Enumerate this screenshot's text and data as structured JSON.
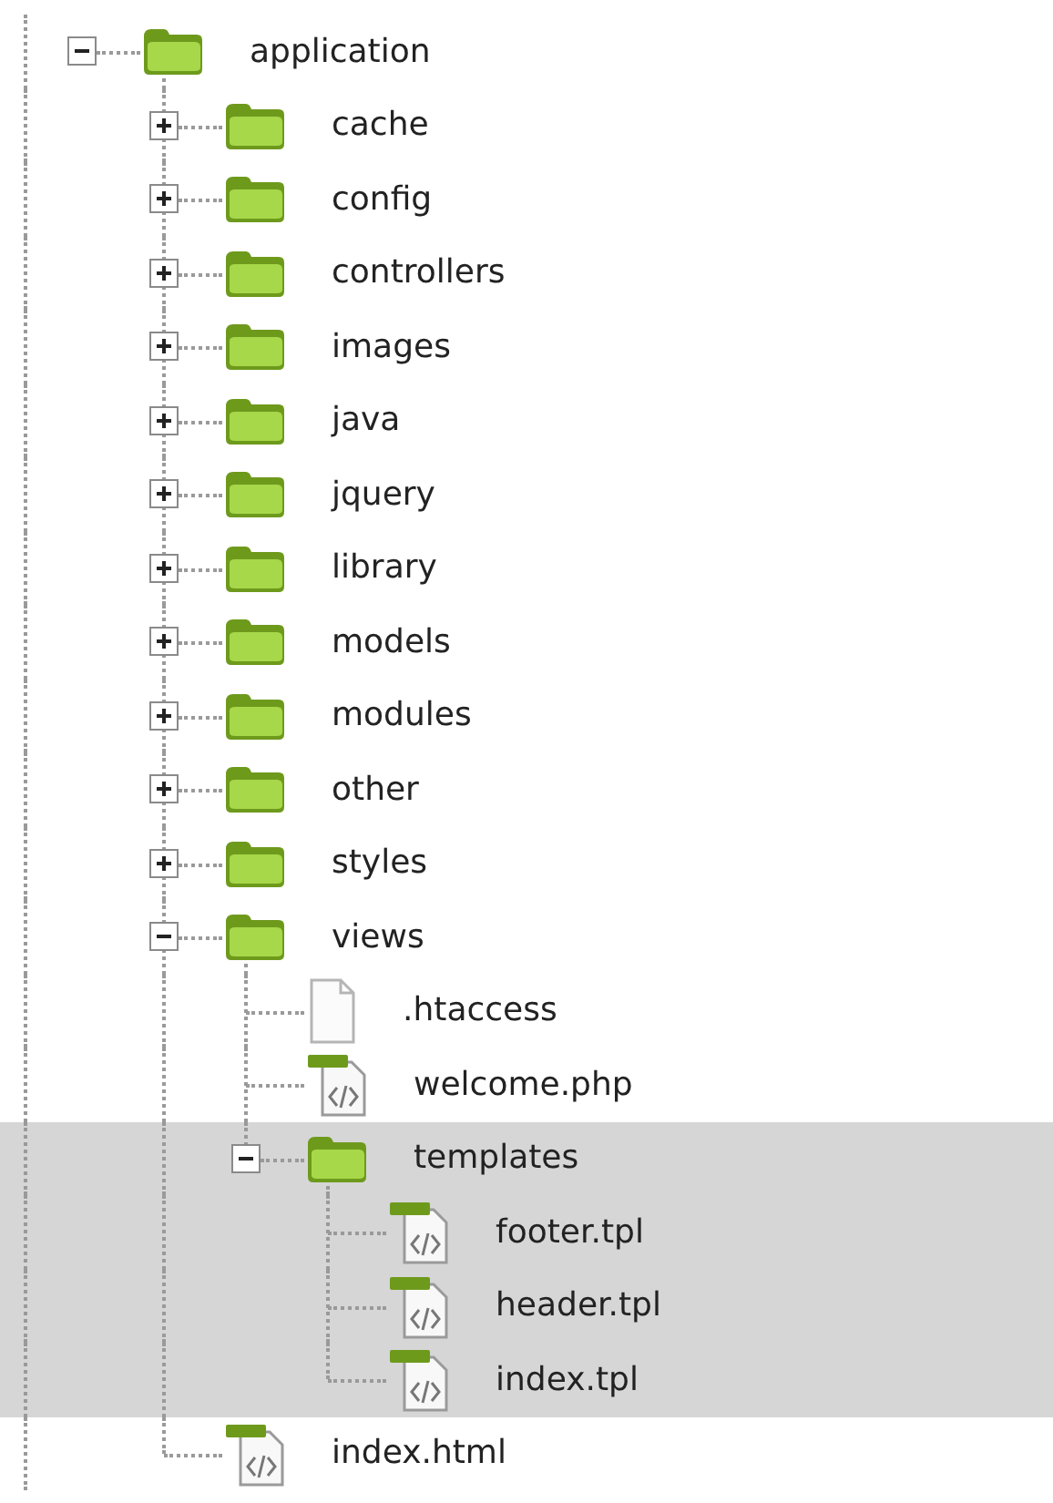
{
  "tree": [
    {
      "label": "application",
      "kind": "folder",
      "expanded": true,
      "selected": false,
      "children": [
        {
          "label": "cache",
          "kind": "folder",
          "expanded": false,
          "selected": false
        },
        {
          "label": "config",
          "kind": "folder",
          "expanded": false,
          "selected": false
        },
        {
          "label": "controllers",
          "kind": "folder",
          "expanded": false,
          "selected": false
        },
        {
          "label": "images",
          "kind": "folder",
          "expanded": false,
          "selected": false
        },
        {
          "label": "java",
          "kind": "folder",
          "expanded": false,
          "selected": false
        },
        {
          "label": "jquery",
          "kind": "folder",
          "expanded": false,
          "selected": false
        },
        {
          "label": "library",
          "kind": "folder",
          "expanded": false,
          "selected": false
        },
        {
          "label": "models",
          "kind": "folder",
          "expanded": false,
          "selected": false
        },
        {
          "label": "modules",
          "kind": "folder",
          "expanded": false,
          "selected": false
        },
        {
          "label": "other",
          "kind": "folder",
          "expanded": false,
          "selected": false
        },
        {
          "label": "styles",
          "kind": "folder",
          "expanded": false,
          "selected": false
        },
        {
          "label": "views",
          "kind": "folder",
          "expanded": true,
          "selected": false,
          "children": [
            {
              "label": ".htaccess",
              "kind": "file",
              "selected": false
            },
            {
              "label": "welcome.php",
              "kind": "code",
              "selected": false
            },
            {
              "label": "templates",
              "kind": "folder",
              "expanded": true,
              "selected": true,
              "children": [
                {
                  "label": "footer.tpl",
                  "kind": "code",
                  "selected": true
                },
                {
                  "label": "header.tpl",
                  "kind": "code",
                  "selected": true
                },
                {
                  "label": "index.tpl",
                  "kind": "code",
                  "selected": true
                }
              ]
            }
          ]
        },
        {
          "label": "index.html",
          "kind": "code",
          "selected": false
        }
      ]
    }
  ]
}
